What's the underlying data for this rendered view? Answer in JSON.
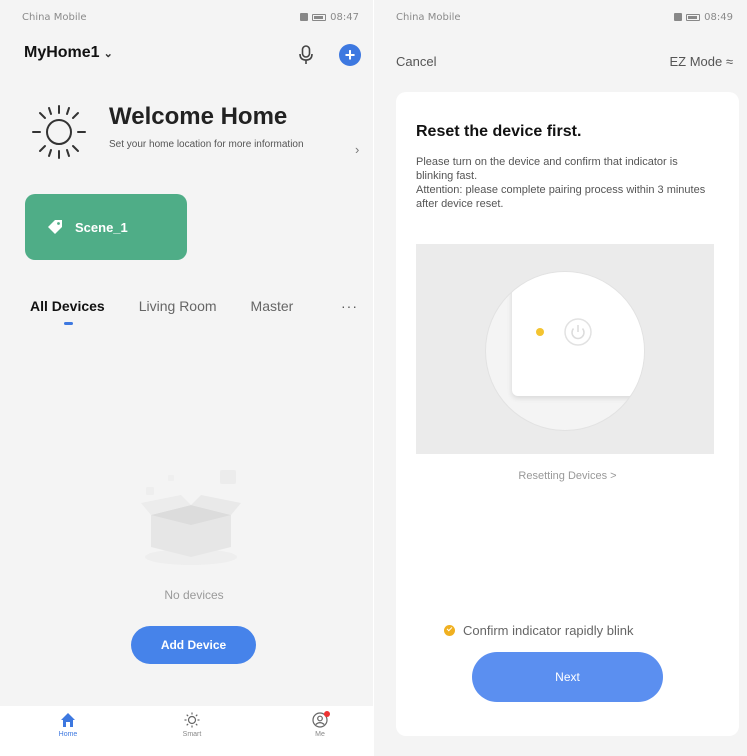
{
  "left": {
    "status": {
      "carrier": "China Mobile",
      "time": "08:47"
    },
    "home_name": "MyHome1",
    "welcome": {
      "title": "Welcome Home",
      "subtitle": "Set your home location for more information"
    },
    "scene": {
      "label": "Scene_1"
    },
    "tabs": [
      "All Devices",
      "Living Room",
      "Master"
    ],
    "more_label": "···",
    "empty_text": "No devices",
    "add_device_label": "Add Device",
    "tabbar": [
      {
        "label": "Home",
        "icon": "home-icon"
      },
      {
        "label": "Smart",
        "icon": "sun-icon"
      },
      {
        "label": "Me",
        "icon": "user-icon"
      }
    ],
    "colors": {
      "accent": "#3d78e0",
      "scene": "#4fad87"
    }
  },
  "right": {
    "status": {
      "carrier": "China Mobile",
      "time": "08:49"
    },
    "cancel_label": "Cancel",
    "mode_label": "EZ Mode ≈",
    "title": "Reset the device first.",
    "description": "Please turn on the device and confirm that indicator is blinking fast.\nAttention: please complete pairing process within 3 minutes after device reset.",
    "resetting_link": "Resetting Devices >",
    "confirm_text": "Confirm indicator rapidly blink",
    "next_label": "Next",
    "colors": {
      "button": "#5b8ff0",
      "indicator": "#f4c430"
    }
  }
}
